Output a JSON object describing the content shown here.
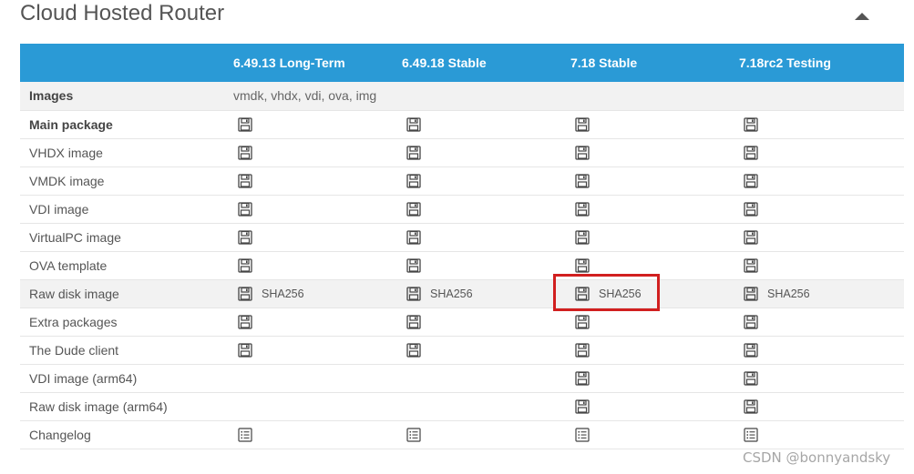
{
  "section": {
    "title": "Cloud Hosted Router"
  },
  "table": {
    "columns": [
      "",
      "6.49.13 Long-Term",
      "6.49.18 Stable",
      "7.18 Stable",
      "7.18rc2 Testing"
    ],
    "images_row": {
      "label": "Images",
      "value": "vmdk, vhdx, vdi, ova, img"
    },
    "rows": [
      {
        "label": "Main package",
        "bold": true,
        "cells": [
          "disk",
          "disk",
          "disk",
          "disk"
        ]
      },
      {
        "label": "VHDX image",
        "bold": false,
        "cells": [
          "disk",
          "disk",
          "disk",
          "disk"
        ]
      },
      {
        "label": "VMDK image",
        "bold": false,
        "cells": [
          "disk",
          "disk",
          "disk",
          "disk"
        ]
      },
      {
        "label": "VDI image",
        "bold": false,
        "cells": [
          "disk",
          "disk",
          "disk",
          "disk"
        ]
      },
      {
        "label": "VirtualPC image",
        "bold": false,
        "cells": [
          "disk",
          "disk",
          "disk",
          "disk"
        ]
      },
      {
        "label": "OVA template",
        "bold": false,
        "cells": [
          "disk",
          "disk",
          "disk",
          "disk"
        ]
      },
      {
        "label": "Raw disk image",
        "bold": false,
        "cells": [
          "disk+sha",
          "disk+sha",
          "disk+sha",
          "disk+sha"
        ]
      },
      {
        "label": "Extra packages",
        "bold": false,
        "cells": [
          "disk",
          "disk",
          "disk",
          "disk"
        ]
      },
      {
        "label": "The Dude client",
        "bold": false,
        "cells": [
          "disk",
          "disk",
          "disk",
          "disk"
        ]
      },
      {
        "label": "VDI image (arm64)",
        "bold": false,
        "cells": [
          "",
          "",
          "disk",
          "disk"
        ]
      },
      {
        "label": "Raw disk image (arm64)",
        "bold": false,
        "cells": [
          "",
          "",
          "disk",
          "disk"
        ]
      },
      {
        "label": "Changelog",
        "bold": false,
        "cells": [
          "list",
          "list",
          "list",
          "list"
        ]
      }
    ],
    "sha_label": "SHA256"
  },
  "icons": {
    "disk": "floppy-disk-icon",
    "list": "changelog-list-icon",
    "toggle": "triangle-up-icon"
  },
  "colors": {
    "header_bg": "#2a9ad6",
    "highlight": "#d11f1f",
    "shaded_row": "#f2f2f2"
  },
  "watermark": "CSDN @bonnyandsky"
}
